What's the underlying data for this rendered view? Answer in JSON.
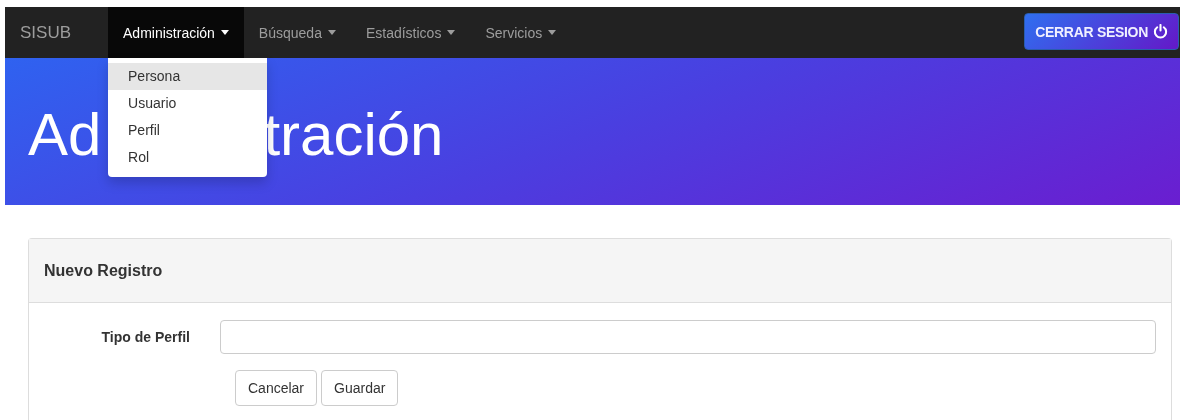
{
  "navbar": {
    "brand": "SISUB",
    "menus": [
      {
        "label": "Administración",
        "selected": true,
        "expanded": true,
        "items": [
          {
            "label": "Persona",
            "selected": true
          },
          {
            "label": "Usuario",
            "selected": false
          },
          {
            "label": "Perfil",
            "selected": false
          },
          {
            "label": "Rol",
            "selected": false
          }
        ]
      },
      {
        "label": "Búsqueda",
        "selected": false
      },
      {
        "label": "Estadísticos",
        "selected": false
      },
      {
        "label": "Servicios",
        "selected": false
      }
    ],
    "logout": "CERRAR SESION"
  },
  "header": {
    "title_parts": [
      "Ad",
      "tración"
    ]
  },
  "panel": {
    "title": "Nuevo Registro",
    "fields": [
      {
        "label": "Tipo de Perfil"
      }
    ],
    "buttons": [
      "Cancelar",
      "Guardar"
    ]
  }
}
